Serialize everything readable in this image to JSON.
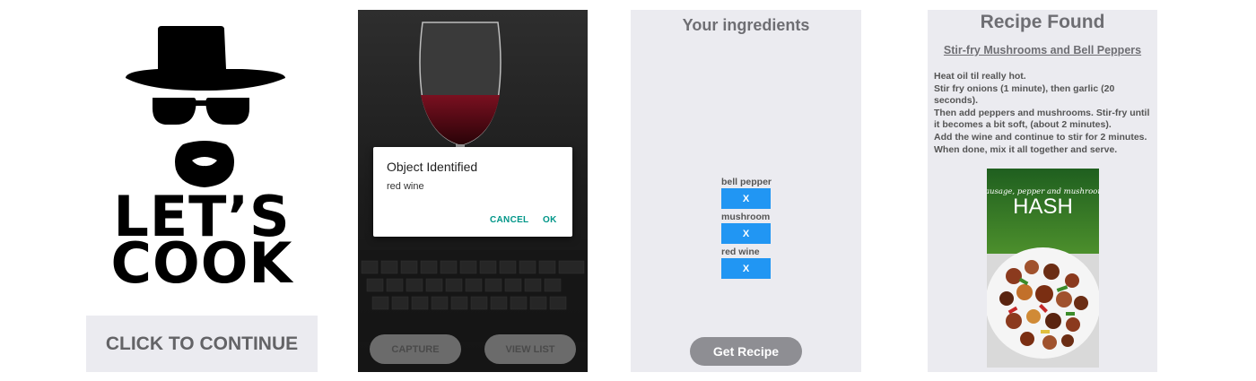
{
  "screen1": {
    "logo_text_line1": "LET’S",
    "logo_text_line2": "COOK",
    "continue_label": "CLICK TO CONTINUE"
  },
  "screen2": {
    "dialog_title": "Object Identified",
    "dialog_message": "red wine",
    "cancel_label": "CANCEL",
    "ok_label": "OK",
    "capture_label": "CAPTURE",
    "view_list_label": "VIEW LIST"
  },
  "screen3": {
    "title": "Your ingredients",
    "ingredients": [
      {
        "name": "bell pepper",
        "remove_label": "X"
      },
      {
        "name": "mushroom",
        "remove_label": "X"
      },
      {
        "name": "red wine",
        "remove_label": "X"
      }
    ],
    "get_recipe_label": "Get Recipe"
  },
  "screen4": {
    "title": "Recipe Found",
    "recipe_name": "Stir-fry Mushrooms and Bell Peppers",
    "steps": [
      "Heat oil til really hot.",
      "Stir fry onions (1 minute), then garlic (20 seconds).",
      "Then add peppers and mushrooms. Stir-fry until it becomes a bit soft, (about 2 minutes).",
      "Add the wine and continue to stir for 2 minutes.",
      "When done, mix it all together and serve."
    ],
    "photo_caption_small": "sausage, pepper and mushroom",
    "photo_caption_big": "HASH"
  },
  "colors": {
    "button_blue": "#2196f3",
    "dialog_accent": "#009688",
    "panel_bg": "#ebebf0",
    "heading_gray": "#6e6e73"
  }
}
